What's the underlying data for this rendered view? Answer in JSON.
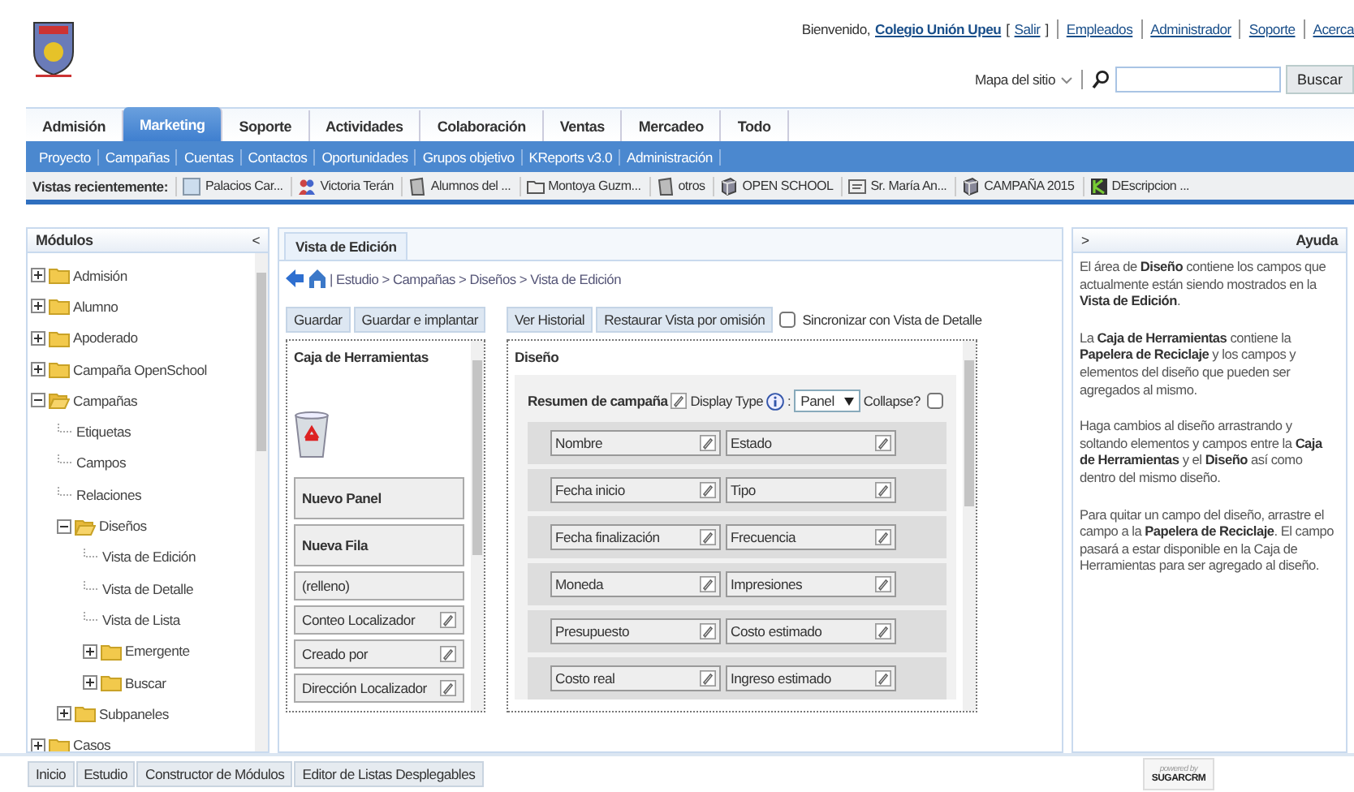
{
  "header": {
    "welcome": "Bienvenido,",
    "user": "Colegio Unión Upeu",
    "logout_open": "[",
    "logout": "Salir",
    "logout_close": "]",
    "links": [
      "Empleados",
      "Administrador",
      "Soporte",
      "Acerca"
    ],
    "sitemap": "Mapa del sitio",
    "search_button": "Buscar"
  },
  "tabs": [
    {
      "label": "Admisión",
      "selected": false
    },
    {
      "label": "Marketing",
      "selected": true
    },
    {
      "label": "Soporte",
      "selected": false
    },
    {
      "label": "Actividades",
      "selected": false
    },
    {
      "label": "Colaboración",
      "selected": false
    },
    {
      "label": "Ventas",
      "selected": false
    },
    {
      "label": "Mercadeo",
      "selected": false
    },
    {
      "label": "Todo",
      "selected": false
    }
  ],
  "subnav": [
    "Proyecto",
    "Campañas",
    "Cuentas",
    "Contactos",
    "Oportunidades",
    "Grupos objetivo",
    "KReports v3.0",
    "Administración"
  ],
  "recent": {
    "label": "Vistas recientemente:",
    "items": [
      {
        "kind": "note",
        "label": "Palacios Car..."
      },
      {
        "kind": "contacts",
        "label": "Victoria Terán"
      },
      {
        "kind": "account",
        "label": "Alumnos del ..."
      },
      {
        "kind": "folder",
        "label": "Montoya Guzm..."
      },
      {
        "kind": "account",
        "label": "otros"
      },
      {
        "kind": "campaign",
        "label": "OPEN SCHOOL"
      },
      {
        "kind": "card",
        "label": "Sr. María An..."
      },
      {
        "kind": "campaign",
        "label": "CAMPAÑA 2015"
      },
      {
        "kind": "report",
        "label": "DEscripcion ..."
      }
    ]
  },
  "modules": {
    "title": "Módulos",
    "collapse": "<",
    "tree": [
      {
        "label": "Admisión",
        "kind": "folder",
        "expanded": false
      },
      {
        "label": "Alumno",
        "kind": "folder",
        "expanded": false
      },
      {
        "label": "Apoderado",
        "kind": "folder",
        "expanded": false
      },
      {
        "label": "Campaña OpenSchool",
        "kind": "folder",
        "expanded": false
      },
      {
        "label": "Campañas",
        "kind": "folder",
        "expanded": true,
        "children": [
          {
            "label": "Etiquetas",
            "kind": "leaf"
          },
          {
            "label": "Campos",
            "kind": "leaf"
          },
          {
            "label": "Relaciones",
            "kind": "leaf"
          },
          {
            "label": "Diseños",
            "kind": "folder",
            "expanded": true,
            "children": [
              {
                "label": "Vista de Edición",
                "kind": "leaf"
              },
              {
                "label": "Vista de Detalle",
                "kind": "leaf"
              },
              {
                "label": "Vista de Lista",
                "kind": "leaf"
              },
              {
                "label": "Emergente",
                "kind": "folder",
                "expanded": false
              },
              {
                "label": "Buscar",
                "kind": "folder",
                "expanded": false
              }
            ]
          },
          {
            "label": "Subpaneles",
            "kind": "folder",
            "expanded": false
          }
        ]
      },
      {
        "label": "Casos",
        "kind": "folder",
        "expanded": false
      }
    ]
  },
  "editor": {
    "tab": {
      "label": "Vista de Edición",
      "selected": true
    },
    "breadcrumb": "| Estudio > Campañas > Diseños > Vista de Edición",
    "left_buttons": [
      "Guardar",
      "Guardar e implantar"
    ],
    "right_buttons": [
      "Ver Historial",
      "Restaurar Vista por omisión"
    ],
    "sync": {
      "label": "Sincronizar con Vista de Detalle",
      "checked": false
    },
    "toolbox": {
      "title": "Caja de Herramientas",
      "items": [
        {
          "kind": "block",
          "label": "Nuevo Panel"
        },
        {
          "kind": "block",
          "label": "Nueva Fila"
        },
        {
          "kind": "plain",
          "label": "(relleno)"
        },
        {
          "kind": "field",
          "label": "Conteo Localizador"
        },
        {
          "kind": "field",
          "label": "Creado por"
        },
        {
          "kind": "field",
          "label": "Dirección Localizador"
        }
      ]
    },
    "layout": {
      "title": "Diseño",
      "panel": {
        "title": "Resumen de campaña",
        "display_type": "Display Type",
        "colon": ":",
        "select": "Panel",
        "collapse": {
          "label": "Collapse?",
          "checked": false
        },
        "rows": [
          [
            "Nombre",
            "Estado"
          ],
          [
            "Fecha inicio",
            "Tipo"
          ],
          [
            "Fecha finalización",
            "Frecuencia"
          ],
          [
            "Moneda",
            "Impresiones"
          ],
          [
            "Presupuesto",
            "Costo estimado"
          ],
          [
            "Costo real",
            "Ingreso estimado"
          ]
        ]
      }
    }
  },
  "help": {
    "toggle": ">",
    "title": "Ayuda",
    "paragraphs": [
      "El área de **Diseño** contiene los campos que actualmente están siendo mostrados en la **Vista de Edición**.",
      "La **Caja de Herramientas** contiene la **Papelera de Reciclaje** y los campos y elementos del diseño que pueden ser agregados al mismo.",
      "Haga cambios al diseño arrastrando y soltando elementos y campos entre la **Caja de Herramientas** y el **Diseño** así como dentro del mismo diseño.",
      "Para quitar un campo del diseño, arrastre el campo a la **Papelera de Reciclaje**. El campo pasará a estar disponible en la Caja de Herramientas para ser agregado al diseño."
    ]
  },
  "footer": {
    "tabs": [
      "Inicio",
      "Estudio",
      "Constructor de Módulos",
      "Editor de Listas Desplegables"
    ],
    "powered_by": "powered by",
    "brand": "SUGARCRM"
  }
}
